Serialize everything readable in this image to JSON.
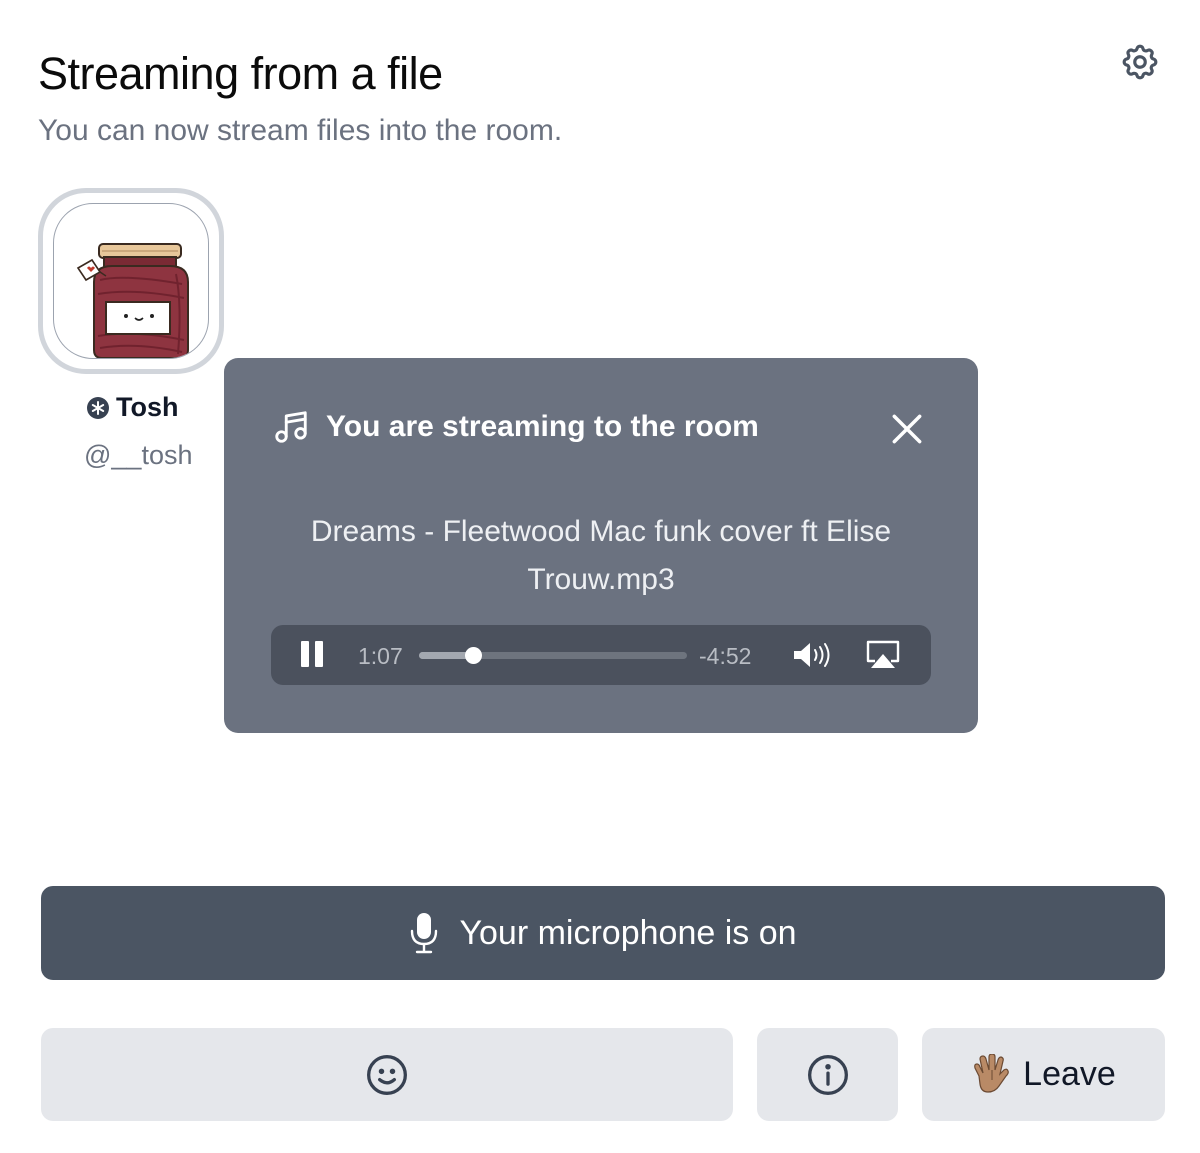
{
  "header": {
    "title": "Streaming from a file",
    "subtitle": "You can now stream files into the room."
  },
  "speaker": {
    "name": "Tosh",
    "handle": "@__tosh",
    "badge_icon": "asterisk-badge-icon"
  },
  "stream_modal": {
    "title": "You are streaming to the room",
    "file_name": "Dreams - Fleetwood Mac funk cover ft Elise Trouw.mp3",
    "player": {
      "time_elapsed": "1:07",
      "time_remaining": "-4:52",
      "progress_fraction": 0.2
    }
  },
  "controls": {
    "microphone_label": "Your microphone is on",
    "leave_label": "Leave",
    "leave_emoji": "🖖🏽"
  },
  "icons": {
    "settings": "gear-icon",
    "music": "music-note-icon",
    "close": "close-icon",
    "pause": "pause-icon",
    "volume": "volume-icon",
    "airplay": "airplay-icon",
    "microphone": "microphone-icon",
    "reaction": "smiley-icon",
    "info": "info-icon"
  },
  "colors": {
    "modal_bg": "#6b7280",
    "player_bg": "#4b515d",
    "mic_button_bg": "#4b5563",
    "secondary_button_bg": "#e5e7eb",
    "subtitle_text": "#6b7280"
  }
}
